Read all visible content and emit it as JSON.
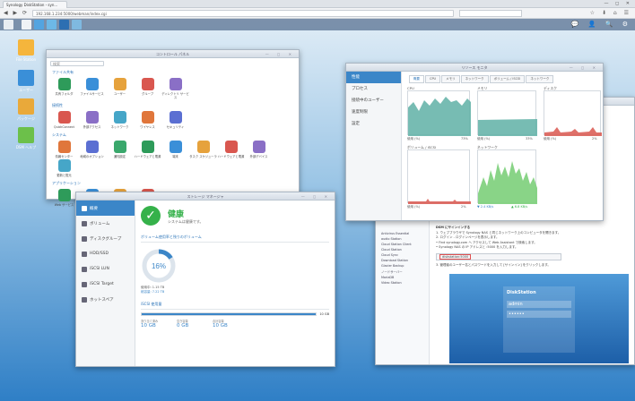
{
  "browser": {
    "tab_title": "Synology DiskStation - syn...",
    "address": "192.168.1.234:5000/webman/index.cgi",
    "window_controls": "— ◻ ✕",
    "nav_icons": "◀ ▶ ⟳",
    "tool_icons": "☆ ⬇ ⌂ ☰"
  },
  "taskbar": {
    "right_icons": "💬 👤 🔍 ⚙"
  },
  "desktop": {
    "icons": [
      {
        "label": "File Station"
      },
      {
        "label": "ユーザー"
      },
      {
        "label": "パッケージ"
      },
      {
        "label": "DSM ヘルプ"
      }
    ]
  },
  "control_panel": {
    "title": "コントロール パネル",
    "search_placeholder": "検索",
    "sections": [
      {
        "label": "ファイル共有",
        "items": [
          "共有フォルダ",
          "ファイルサービス",
          "ユーザー",
          "グループ",
          "ディレクトリ サービス"
        ]
      },
      {
        "label": "接続性",
        "items": [
          "QuickConnect",
          "外部アクセス",
          "ネットワーク",
          "ワイヤレス",
          "セキュリティ"
        ]
      },
      {
        "label": "システム",
        "items": [
          "情報センター",
          "地域のオプション",
          "通知設定",
          "ハードウェアと電源",
          "端末",
          "タスク スケジューラ",
          "ハードウェアと電源",
          "外部デバイス",
          "更新と復元"
        ]
      },
      {
        "label": "アプリケーション",
        "items": [
          "Web サービス",
          "権限",
          "アプリケーション ポータル",
          "メディア ライブラリ"
        ]
      }
    ]
  },
  "resource_monitor": {
    "title": "リソース モニタ",
    "sidebar": [
      "性能",
      "プロセス",
      "接続中のユーザー",
      "速度制限",
      "設定"
    ],
    "tabs": [
      "概要",
      "CPU",
      "メモリ",
      "ネットワーク",
      "ボリューム / iSCSI",
      "ネットワーク"
    ],
    "graphs": [
      {
        "label": "CPU",
        "stat_left": "使用 (%)",
        "stat_right": "73%"
      },
      {
        "label": "メモリ",
        "stat_left": "使用 (%)",
        "stat_right": "33%"
      },
      {
        "label": "ディスク",
        "stat_left": "使用 (%)",
        "stat_right": "2%"
      },
      {
        "label": "ボリューム / iSCSI",
        "stat_left": "使用 (%)",
        "stat_right": "2%"
      },
      {
        "label": "ネットワーク",
        "stat_left": "▼ 2.4 KB/s",
        "stat_right": "▲ 6.8 KB/s"
      }
    ]
  },
  "storage_manager": {
    "title": "ストレージ マネージャ",
    "sidebar": [
      "概要",
      "ボリューム",
      "ディスクグループ",
      "HDD/SSD",
      "iSCSI LUN",
      "iSCSI Target",
      "ホットスペア"
    ],
    "status_title": "健康",
    "status_sub": "システムは健康です。",
    "volume_header": "ボリューム使用率と残りのボリューム",
    "volume_percent": "16%",
    "volume_detail": "使用中: 1.15 TB",
    "volume_detail2": "総容量: 7.22 TB",
    "iscsi_header": "iSCSI 使用量",
    "iscsi_cols": [
      {
        "label": "割り当て済み",
        "value": "10 GB"
      },
      {
        "label": "空き容量",
        "value": "0 GB"
      },
      {
        "label": "合計容量",
        "value": "10 GB"
      }
    ],
    "iscsi_total": "10 GB"
  },
  "bg_window": {
    "section_title": "DSM にサインインする",
    "lines": [
      "1. ウェブブラウザで Synology NAS と同じネットワーク上のコンピュータを開きます。",
      "2. ログイン - ログインページを表示します。",
      "• Find synology.com へ アクセスして Web Assistant で検索します。",
      "• Synology NAS の IP アドレスと :5000 を入力します。",
      "3. 管理者のユーザー名とパスワードを入力して [サインイン] をクリックします。"
    ],
    "tree": [
      "Antivirus Essential",
      "audio Station",
      "Cloud Station Client",
      "Cloud Station",
      "Cloud Sync",
      "Download Station",
      "Glacier Backup",
      "ノードサーバー",
      "MariaDB",
      "Video Station"
    ],
    "url_in_image": "diskstation:5000",
    "login_title": "DiskStation",
    "login_user": "admin",
    "login_pass": "••••••"
  },
  "colors": {
    "accent": "#3b86c8",
    "health_green": "#35b14a",
    "graph_green": "#7ccf7a",
    "graph_teal": "#5fb0a6",
    "graph_red": "#d9574f"
  }
}
